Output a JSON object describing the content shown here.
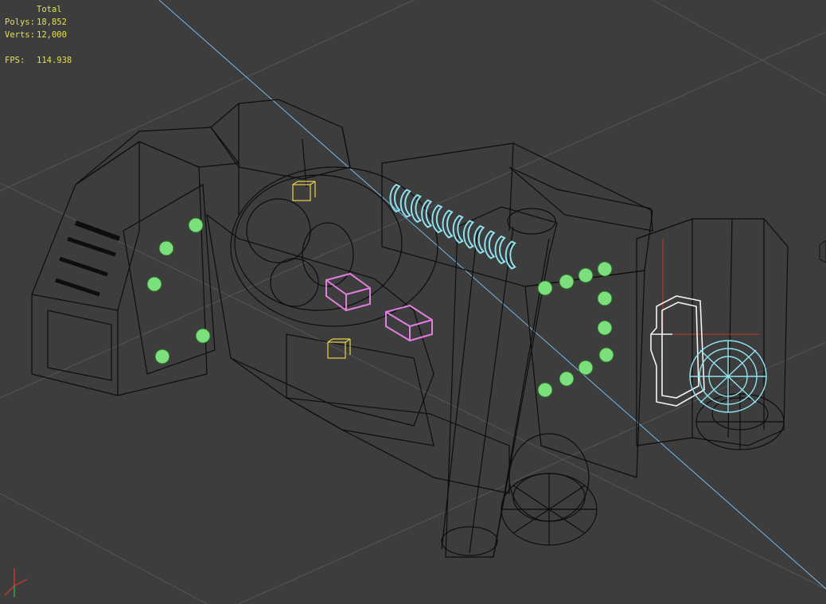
{
  "stats": {
    "header": "Total",
    "polys_label": "Polys:",
    "polys_value": "18,852",
    "verts_label": "Verts:",
    "verts_value": "12,000",
    "fps_label": "FPS:",
    "fps_value": "114.938"
  },
  "colors": {
    "background": "#3d3d3d",
    "grid": "#555555",
    "wire": "#0d0d0d",
    "stats_text": "#e6e050",
    "light_green": "#7be07b",
    "selected_cyan": "#8fe3f0",
    "selected_magenta": "#e27ee0",
    "selected_white": "#f2f2f2",
    "helper_yellow": "#e8d24a",
    "camera_line": "#77b8e8",
    "gizmo_red": "#c0392b"
  },
  "icons": {
    "axis": "axis-tripod-icon"
  }
}
